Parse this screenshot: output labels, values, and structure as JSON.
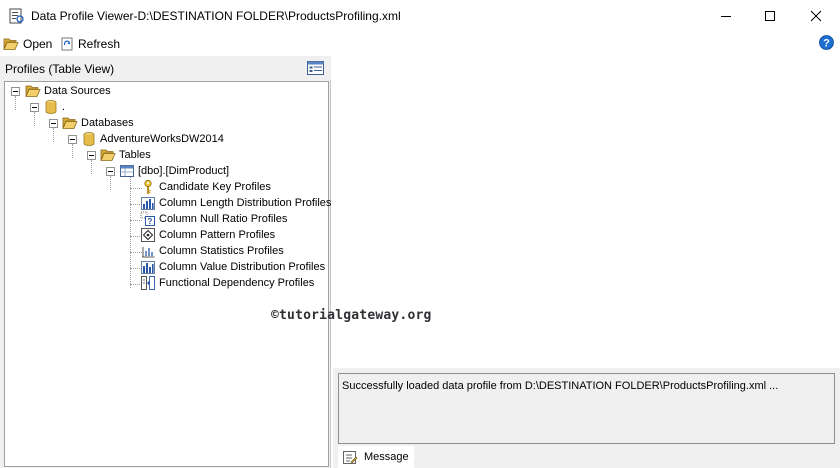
{
  "window": {
    "title": "Data Profile Viewer-D:\\DESTINATION FOLDER\\ProductsProfiling.xml",
    "controls": [
      "minimize",
      "maximize",
      "close"
    ]
  },
  "toolbar": {
    "open_label": "Open",
    "refresh_label": "Refresh",
    "icons": {
      "open": "folder-open-icon",
      "refresh": "refresh-icon",
      "help": "help-icon"
    }
  },
  "profiles_panel": {
    "title": "Profiles (Table View)",
    "tree": {
      "data_sources": "Data Sources",
      "server": ".",
      "databases": "Databases",
      "database": "AdventureWorksDW2014",
      "tables": "Tables",
      "table": "[dbo].[DimProduct]",
      "profiles": [
        {
          "label": "Candidate Key Profiles",
          "icon": "key-icon"
        },
        {
          "label": "Column Length Distribution Profiles",
          "icon": "bar-chart-icon"
        },
        {
          "label": "Column Null Ratio Profiles",
          "icon": "null-ratio-icon"
        },
        {
          "label": "Column Pattern Profiles",
          "icon": "pattern-icon"
        },
        {
          "label": "Column Statistics Profiles",
          "icon": "statistics-icon"
        },
        {
          "label": "Column Value Distribution Profiles",
          "icon": "bar-chart-icon"
        },
        {
          "label": "Functional Dependency Profiles",
          "icon": "dependency-icon"
        }
      ]
    }
  },
  "watermark": "©tutorialgateway.org",
  "message_panel": {
    "text": "Successfully loaded data profile from D:\\DESTINATION FOLDER\\ProductsProfiling.xml ...",
    "tab_label": "Message"
  },
  "colors": {
    "panel_bg": "#f0f0f0",
    "folder_yellow": "#e8c45a",
    "help_blue": "#1c6fd1"
  }
}
